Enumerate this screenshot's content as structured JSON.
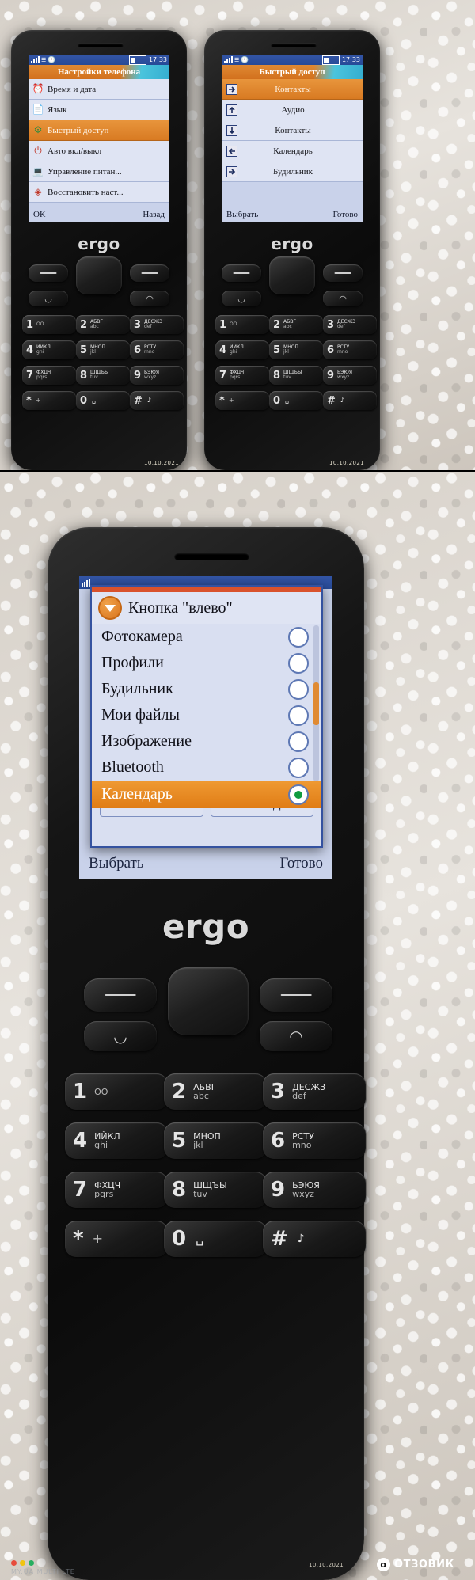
{
  "phone_brand": "ergo",
  "status_bar": {
    "time": "17:33",
    "signal_icon": "signal-bars-icon",
    "clock_icon": "clock-icon",
    "battery_icon": "battery-icon"
  },
  "phone1": {
    "title": "Настройки телефона",
    "items": [
      {
        "label": "Время и дата",
        "icon": "clock-alarm-icon",
        "selected": false
      },
      {
        "label": "Язык",
        "icon": "language-icon",
        "selected": false
      },
      {
        "label": "Быстрый доступ",
        "icon": "shortcut-icon",
        "selected": true
      },
      {
        "label": "Авто вкл/выкл",
        "icon": "power-icon",
        "selected": false
      },
      {
        "label": "Управление питан...",
        "icon": "power-manager-icon",
        "selected": false
      },
      {
        "label": "Восстановить наст...",
        "icon": "restore-icon",
        "selected": false
      }
    ],
    "softkeys": {
      "left": "ОК",
      "right": "Назад"
    }
  },
  "phone2": {
    "title": "Быстрый доступ",
    "items": [
      {
        "label": "Контакты",
        "icon": "key-center-icon",
        "selected": true
      },
      {
        "label": "Аудио",
        "icon": "arrow-up-icon",
        "selected": false
      },
      {
        "label": "Контакты",
        "icon": "arrow-down-icon",
        "selected": false
      },
      {
        "label": "Календарь",
        "icon": "arrow-left-icon",
        "selected": false
      },
      {
        "label": "Будильник",
        "icon": "arrow-right-icon",
        "selected": false
      }
    ],
    "softkeys": {
      "left": "Выбрать",
      "right": "Готово"
    }
  },
  "phone3": {
    "dialog": {
      "title": "Кнопка \"влево\"",
      "badge_icon": "chevron-down-badge-icon",
      "options": [
        {
          "label": "Фотокамера",
          "selected": false
        },
        {
          "label": "Профили",
          "selected": false
        },
        {
          "label": "Будильник",
          "selected": false
        },
        {
          "label": "Мои файлы",
          "selected": false
        },
        {
          "label": "Изображение",
          "selected": false
        },
        {
          "label": "Bluetooth",
          "selected": false
        },
        {
          "label": "Календарь",
          "selected": true
        }
      ],
      "buttons": {
        "ok": "ОК",
        "back": "Назад"
      }
    },
    "softkeys": {
      "left": "Выбрать",
      "right": "Готово"
    }
  },
  "keypad": {
    "keys": [
      {
        "digit": "1",
        "cyr": "",
        "lat": "ОО",
        "name": "key-1"
      },
      {
        "digit": "2",
        "cyr": "АБВГ",
        "lat": "abc",
        "name": "key-2"
      },
      {
        "digit": "3",
        "cyr": "ДЕСЖЗ",
        "lat": "def",
        "name": "key-3"
      },
      {
        "digit": "4",
        "cyr": "ИЙКЛ",
        "lat": "ghi",
        "name": "key-4"
      },
      {
        "digit": "5",
        "cyr": "МНОП",
        "lat": "jkl",
        "name": "key-5"
      },
      {
        "digit": "6",
        "cyr": "РСТУ",
        "lat": "mno",
        "name": "key-6"
      },
      {
        "digit": "7",
        "cyr": "ФХЦЧ",
        "lat": "pqrs",
        "name": "key-7"
      },
      {
        "digit": "8",
        "cyr": "ШЩЪЫ",
        "lat": "tuv",
        "name": "key-8"
      },
      {
        "digit": "9",
        "cyr": "ЬЭЮЯ",
        "lat": "wxyz",
        "name": "key-9"
      },
      {
        "digit": "*",
        "cyr": "",
        "lat": "+",
        "name": "key-star"
      },
      {
        "digit": "0",
        "cyr": "",
        "lat": "",
        "name": "key-0"
      },
      {
        "digit": "#",
        "cyr": "",
        "lat": "",
        "name": "key-hash"
      }
    ]
  },
  "watermarks": {
    "date": "10.10.2021",
    "lte_text": "MY.UA MULTI LTE",
    "brand": "ОТЗОВИК",
    "brand_glyph": "o"
  },
  "colors": {
    "title_orange": "#d2701d",
    "title_cyan": "#3fb9d6",
    "status_blue": "#2f519f",
    "selection_orange": "#e07c15",
    "screen_bg": "#dfe4f3",
    "dialog_border": "#3452a0",
    "radio_green": "#0f9b3f"
  }
}
